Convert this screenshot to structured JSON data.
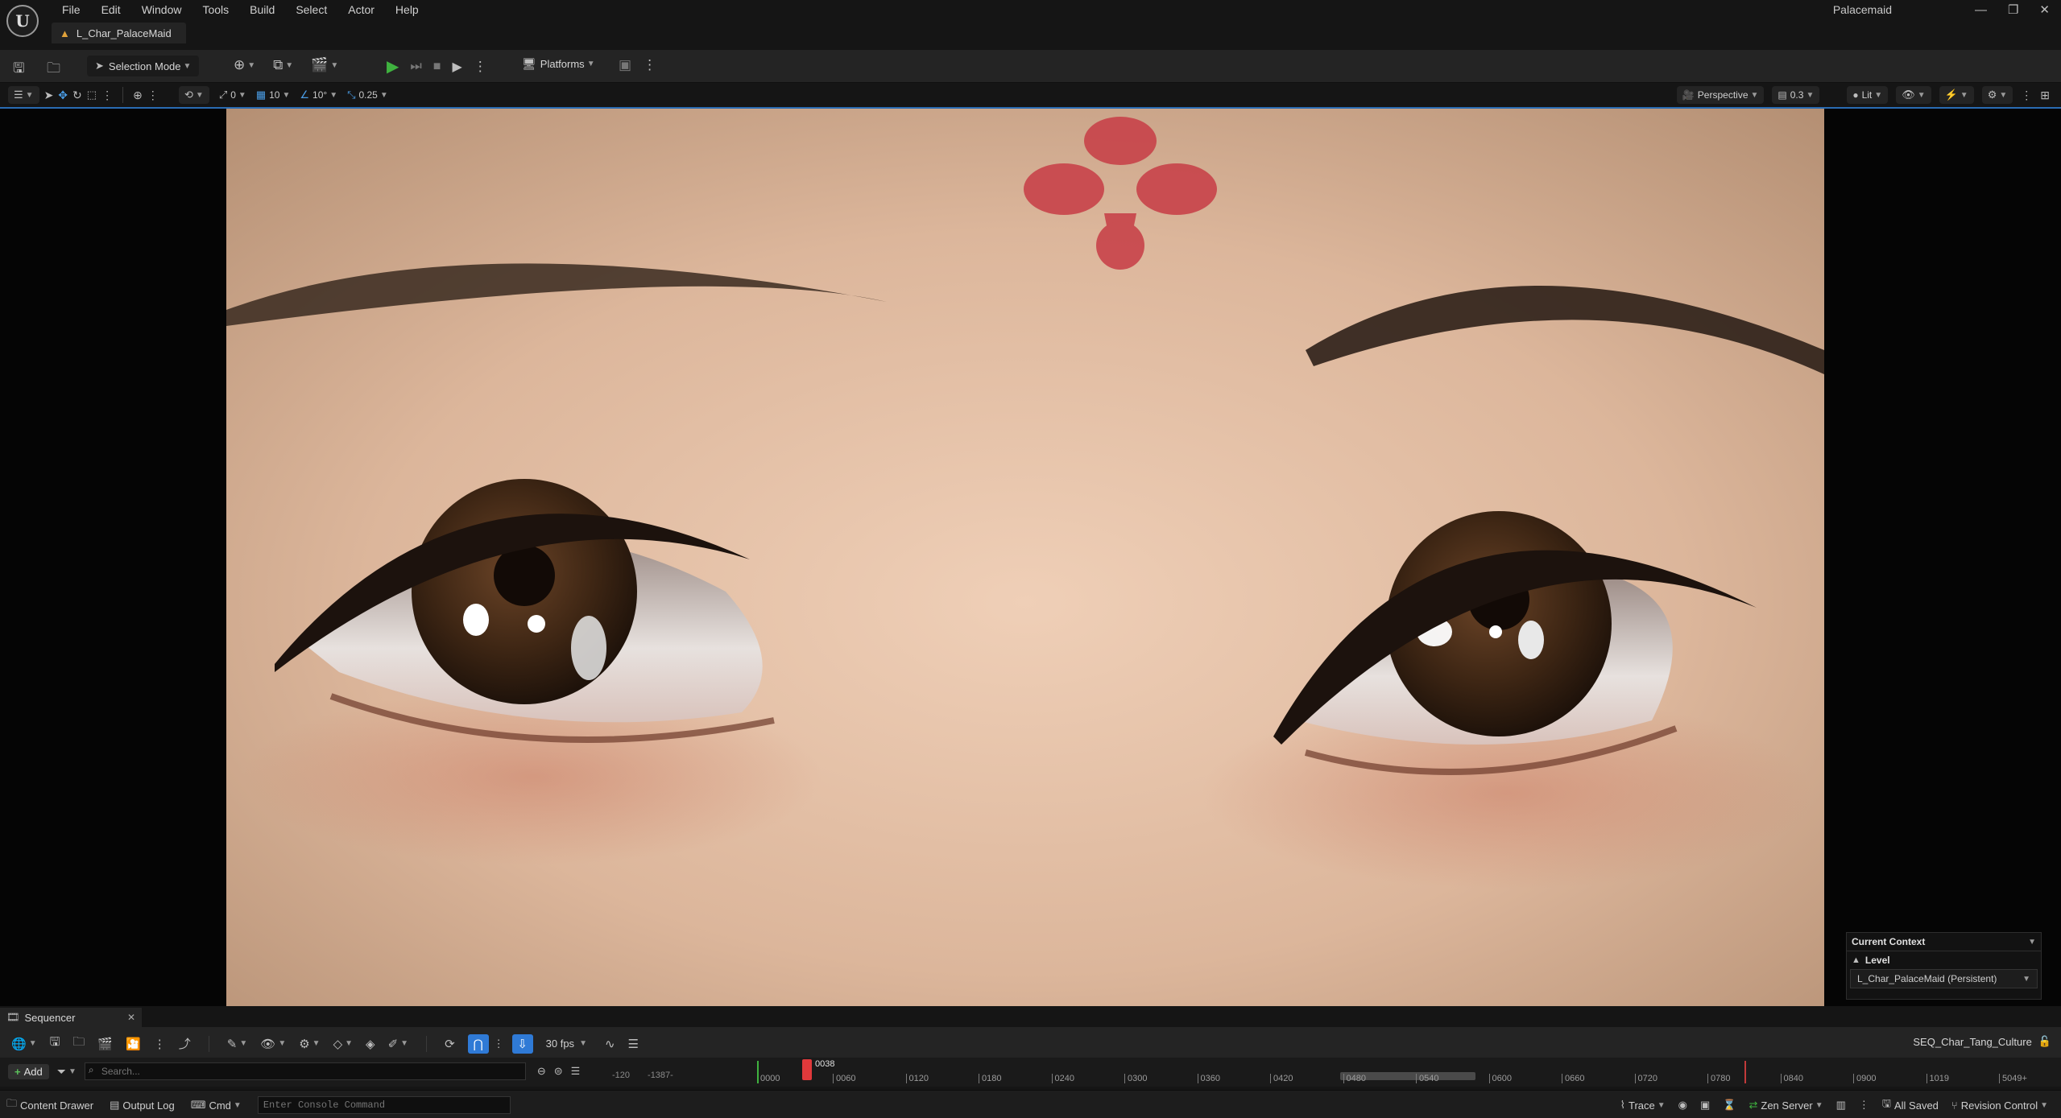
{
  "window": {
    "app_name": "Palacemaid",
    "level_tab": "L_Char_PalaceMaid",
    "controls": [
      "—",
      "❐",
      "✕"
    ]
  },
  "menu": [
    "File",
    "Edit",
    "Window",
    "Tools",
    "Build",
    "Select",
    "Actor",
    "Help"
  ],
  "toolbar": {
    "selection_mode": "Selection Mode",
    "platforms": "Platforms"
  },
  "viewport_toolbar": {
    "rotation_snap_value": "0",
    "grid_snap_value": "10",
    "angle_snap_value": "10°",
    "scale_snap_value": "0.25",
    "view_mode": "Perspective",
    "screen_percentage": "0.3",
    "lighting_mode": "Lit"
  },
  "current_context": {
    "header": "Current Context",
    "level_label": "Level",
    "level_value": "L_Char_PalaceMaid (Persistent)"
  },
  "sequencer": {
    "tab_label": "Sequencer",
    "add_label": "Add",
    "search_placeholder": "Search...",
    "fps": "30 fps",
    "sequence_name": "SEQ_Char_Tang_Culture",
    "current_frame": "0038",
    "left_frame_labels": [
      "-120",
      "-1387-",
      "0000"
    ],
    "ruler_labels": [
      "0060",
      "0120",
      "0180",
      "0240",
      "0300",
      "0360",
      "0420",
      "0480",
      "0540",
      "0600",
      "0660",
      "0720",
      "0780",
      "0840",
      "0900",
      "1019",
      "5049+"
    ]
  },
  "statusbar": {
    "content_drawer": "Content Drawer",
    "output_log": "Output Log",
    "cmd": "Cmd",
    "console_placeholder": "Enter Console Command",
    "trace": "Trace",
    "zen_server": "Zen Server",
    "all_saved": "All Saved",
    "revision_control": "Revision Control"
  },
  "colors": {
    "accent_blue": "#2a6cb3",
    "play_green": "#3fb23f",
    "playhead_red": "#e0393b"
  }
}
